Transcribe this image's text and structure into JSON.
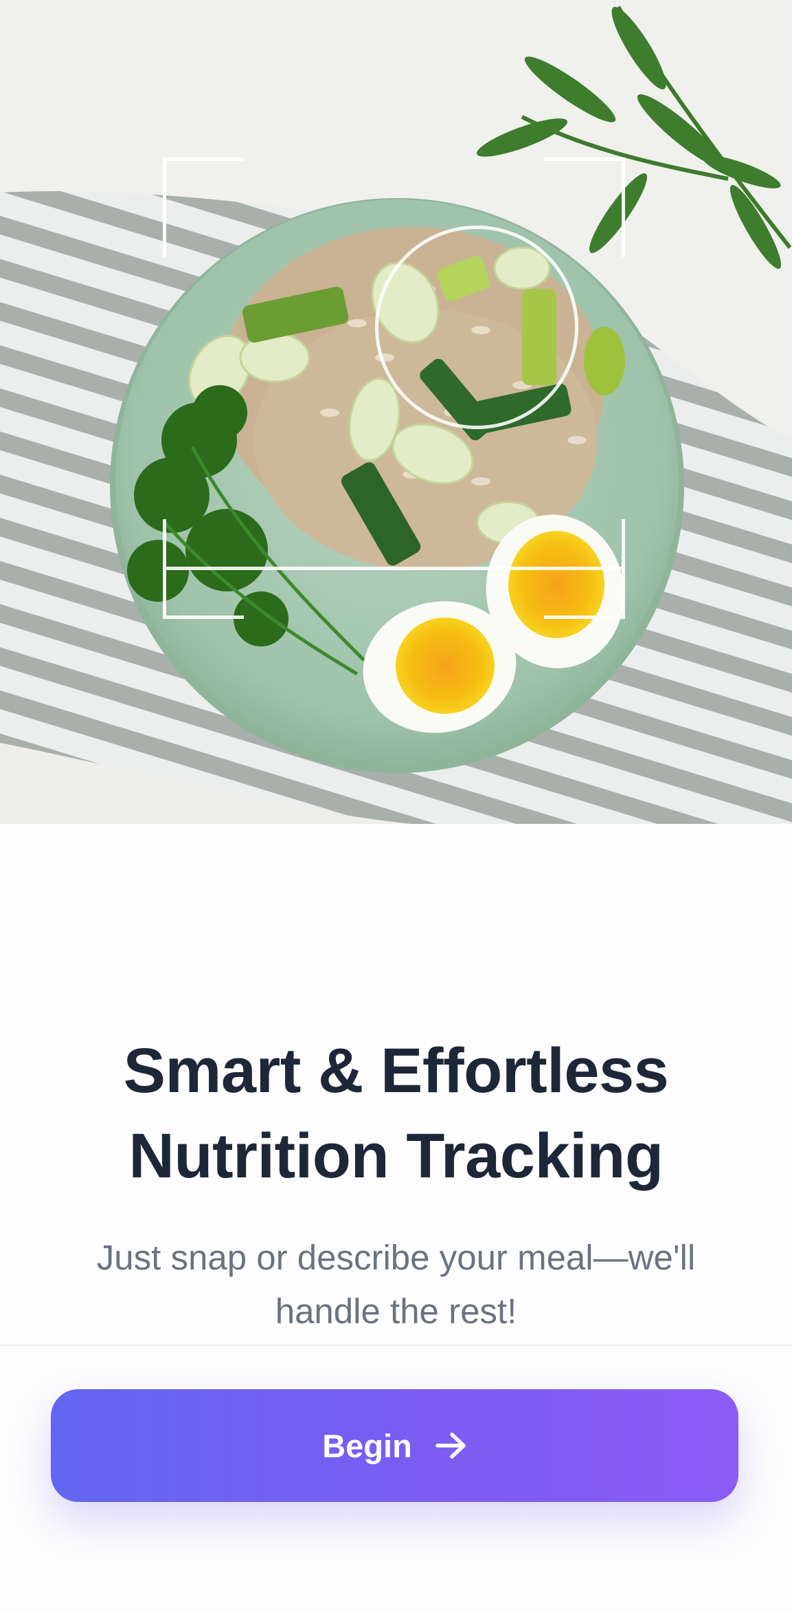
{
  "hero": {
    "icon": "meal-scan-photo",
    "overlay_icon": "scan-frame-icon"
  },
  "onboarding": {
    "title_line1": "Smart & Effortless",
    "title_line2": "Nutrition Tracking",
    "subtitle_line1": "Just snap or describe your meal—we'll",
    "subtitle_line2": "handle the rest!"
  },
  "cta": {
    "label": "Begin",
    "icon": "arrow-right-icon"
  },
  "colors": {
    "title": "#1e2738",
    "subtitle": "#6b7280",
    "accent_start": "#6366f1",
    "accent_end": "#8b5cf6"
  }
}
